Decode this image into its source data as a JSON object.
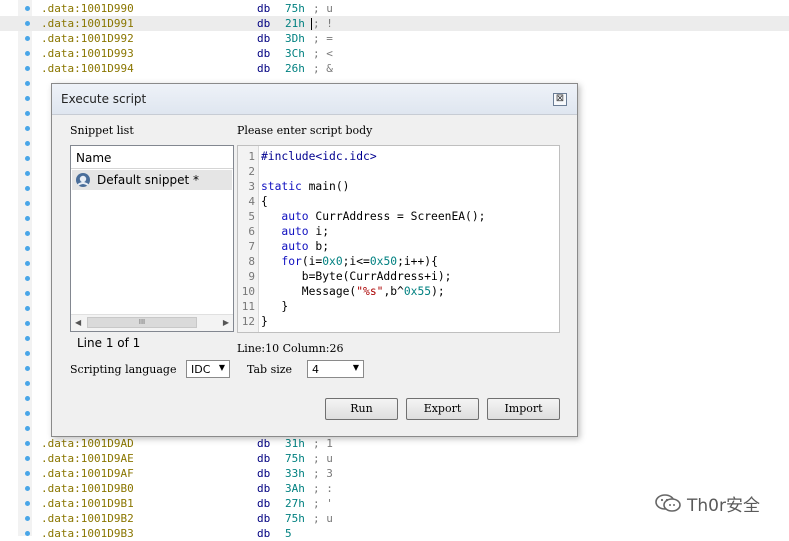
{
  "disasm": {
    "top_rows": [
      {
        "addr": ".data:1001D990",
        "op": "db",
        "val": "75h",
        "cmt": "; u"
      },
      {
        "addr": ".data:1001D991",
        "op": "db",
        "val": "21h",
        "cmt": "; !"
      },
      {
        "addr": ".data:1001D992",
        "op": "db",
        "val": "3Dh",
        "cmt": "; ="
      },
      {
        "addr": ".data:1001D993",
        "op": "db",
        "val": "3Ch",
        "cmt": "; <"
      },
      {
        "addr": ".data:1001D994",
        "op": "db",
        "val": "26h",
        "cmt": "; &"
      }
    ],
    "bottom_rows": [
      {
        "addr": ".data:1001D9AD",
        "op": "db",
        "val": "31h",
        "cmt": "; 1"
      },
      {
        "addr": ".data:1001D9AE",
        "op": "db",
        "val": "75h",
        "cmt": "; u"
      },
      {
        "addr": ".data:1001D9AF",
        "op": "db",
        "val": "33h",
        "cmt": "; 3"
      },
      {
        "addr": ".data:1001D9B0",
        "op": "db",
        "val": "3Ah",
        "cmt": "; :"
      },
      {
        "addr": ".data:1001D9B1",
        "op": "db",
        "val": "27h",
        "cmt": "; '"
      },
      {
        "addr": ".data:1001D9B2",
        "op": "db",
        "val": "75h",
        "cmt": "; u"
      },
      {
        "addr": ".data:1001D9B3",
        "op": "db",
        "val": "5",
        "cmt": ""
      }
    ]
  },
  "dialog": {
    "title": "Execute script",
    "close_glyph": "⊠",
    "snippet_list_label": "Snippet list",
    "snippet_header": "Name",
    "snippet_item": "Default snippet *",
    "scroll_thumb": "III",
    "line_of": "Line 1 of 1",
    "script_body_label": "Please enter script body",
    "code_lines": [
      {
        "n": "1",
        "html": "<span class='pp'>#include&lt;idc.idc&gt;</span>"
      },
      {
        "n": "2",
        "html": ""
      },
      {
        "n": "3",
        "html": "<span class='kw'>static</span> main()"
      },
      {
        "n": "4",
        "html": "{"
      },
      {
        "n": "5",
        "html": "   <span class='kw'>auto</span> CurrAddress = ScreenEA();"
      },
      {
        "n": "6",
        "html": "   <span class='kw'>auto</span> i;"
      },
      {
        "n": "7",
        "html": "   <span class='kw'>auto</span> b;"
      },
      {
        "n": "8",
        "html": "   <span class='kw'>for</span>(i=<span class='num'>0x0</span>;i&lt;=<span class='num'>0x50</span>;i++){"
      },
      {
        "n": "9",
        "html": "      b=Byte(CurrAddress+i);"
      },
      {
        "n": "10",
        "html": "      Message(<span class='str'>\"%s\"</span>,b^<span class='num'>0x55</span>);"
      },
      {
        "n": "11",
        "html": "   }"
      },
      {
        "n": "12",
        "html": "}"
      }
    ],
    "cursor_status": "Line:10 Column:26",
    "scripting_language_label": "Scripting language",
    "scripting_language_value": "IDC",
    "tab_size_label": "Tab size",
    "tab_size_value": "4",
    "run_label": "Run",
    "export_label": "Export",
    "import_label": "Import"
  },
  "watermark": {
    "text": "Th0r安全"
  },
  "colors": {
    "address": "#8a7600",
    "keyword": "#1010c0",
    "number": "#008080",
    "string": "#aa0000",
    "marker": "#49a6e8"
  }
}
